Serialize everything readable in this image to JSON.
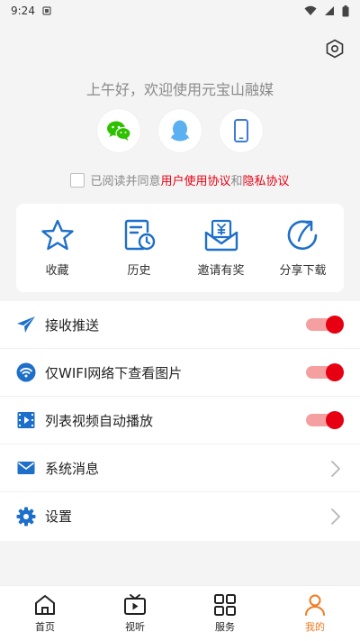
{
  "status_bar": {
    "time": "9:24"
  },
  "greeting": "上午好，欢迎使用元宝山融媒",
  "agreement": {
    "prefix": "已阅读并同意",
    "user_agreement": "用户使用协议",
    "and": "和",
    "privacy": "隐私协议"
  },
  "quick_actions": [
    {
      "label": "收藏",
      "icon": "star-icon"
    },
    {
      "label": "历史",
      "icon": "history-icon"
    },
    {
      "label": "邀请有奖",
      "icon": "invite-reward-icon"
    },
    {
      "label": "分享下载",
      "icon": "share-icon"
    }
  ],
  "settings_list": [
    {
      "label": "接收推送",
      "icon": "paper-plane-icon",
      "control": "toggle",
      "on": true
    },
    {
      "label": "仅WIFI网络下查看图片",
      "icon": "wifi-icon",
      "control": "toggle",
      "on": true
    },
    {
      "label": "列表视频自动播放",
      "icon": "video-icon",
      "control": "toggle",
      "on": true
    },
    {
      "label": "系统消息",
      "icon": "mail-icon",
      "control": "chevron"
    },
    {
      "label": "设置",
      "icon": "gear-icon",
      "control": "chevron"
    }
  ],
  "tabs": [
    {
      "label": "首页",
      "icon": "home-icon",
      "active": false
    },
    {
      "label": "视听",
      "icon": "tv-icon",
      "active": false
    },
    {
      "label": "服务",
      "icon": "grid-icon",
      "active": false
    },
    {
      "label": "我的",
      "icon": "user-icon",
      "active": true
    }
  ],
  "colors": {
    "accent_red": "#e60012",
    "icon_blue": "#1e6fc9",
    "active_tab": "#f07b21",
    "wechat_green": "#2dc100",
    "qq_blue": "#5ab0f0"
  }
}
